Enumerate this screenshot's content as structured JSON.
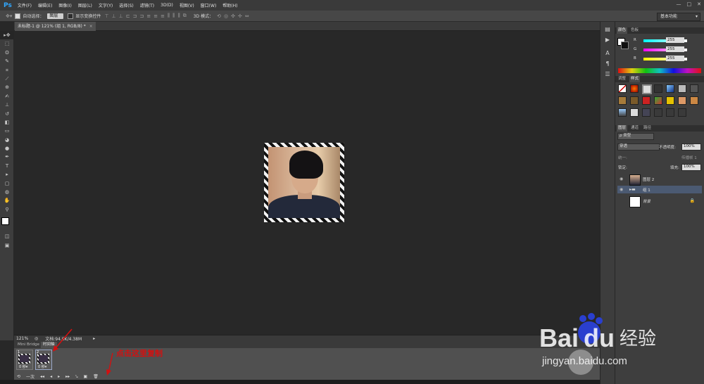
{
  "menubar": {
    "logo": "Ps",
    "items": [
      "文件(F)",
      "编辑(E)",
      "图像(I)",
      "图层(L)",
      "文字(Y)",
      "选择(S)",
      "滤镜(T)",
      "3D(D)",
      "视图(V)",
      "窗口(W)",
      "帮助(H)"
    ],
    "window_controls": [
      "—",
      "□",
      "✕"
    ]
  },
  "options": {
    "auto_select_label": "自动选择：",
    "auto_select_value": "图层",
    "show_transform_label": "显示变换控件",
    "mode_3d_label": "3D 模式：",
    "workspace": "基本功能"
  },
  "document": {
    "tab_title": "未标题-1 @ 121% (组 1, RGB/8) *"
  },
  "status": {
    "zoom": "121%",
    "doc_info": "文档:94.9K/4.38M"
  },
  "timeline": {
    "tabs": [
      "Mini Bridge",
      "时间轴"
    ],
    "frames": [
      {
        "num": "1",
        "duration": "0 秒▾"
      },
      {
        "num": "2",
        "duration": "0 秒▾"
      }
    ],
    "loop": "一次",
    "controls": [
      "⟲",
      "◂◂",
      "◂",
      "▸",
      "▸▸",
      "⤥",
      "▣",
      "🗑"
    ]
  },
  "annotation": {
    "text": "点击这里复制",
    "color": "#d31010"
  },
  "color_panel": {
    "tabs": [
      "颜色",
      "色板"
    ],
    "channels": [
      {
        "label": "R",
        "value": "255",
        "color": "#e83030"
      },
      {
        "label": "G",
        "value": "255",
        "color": "#30c030"
      },
      {
        "label": "B",
        "value": "255",
        "color": "#3050e0"
      }
    ]
  },
  "adjust_panel": {
    "tabs": [
      "调整",
      "样式"
    ]
  },
  "layers_panel": {
    "tabs": [
      "图层",
      "通道",
      "路径"
    ],
    "filter_kind": "ρ 类型",
    "blend_mode": "穿透",
    "opacity_label": "不透明度:",
    "opacity_value": "100%",
    "unify_label": "统一:",
    "propagate_label": "传播帧 1",
    "lock_label": "锁定:",
    "fill_label": "填充:",
    "fill_value": "100%",
    "layers": [
      {
        "name": "图层 2",
        "type": "pixel"
      },
      {
        "name": "组 1",
        "type": "group",
        "selected": true
      },
      {
        "name": "背景",
        "type": "background",
        "locked": true
      }
    ]
  },
  "watermark": {
    "brand": "Bai",
    "brand2": "du",
    "brand_cn": "经验",
    "url": "jingyan.baidu.com"
  },
  "accent_colors": {
    "ps_blue": "#31a8ff",
    "selection": "#4b5a72",
    "baidu_blue": "#2a3fcf"
  }
}
